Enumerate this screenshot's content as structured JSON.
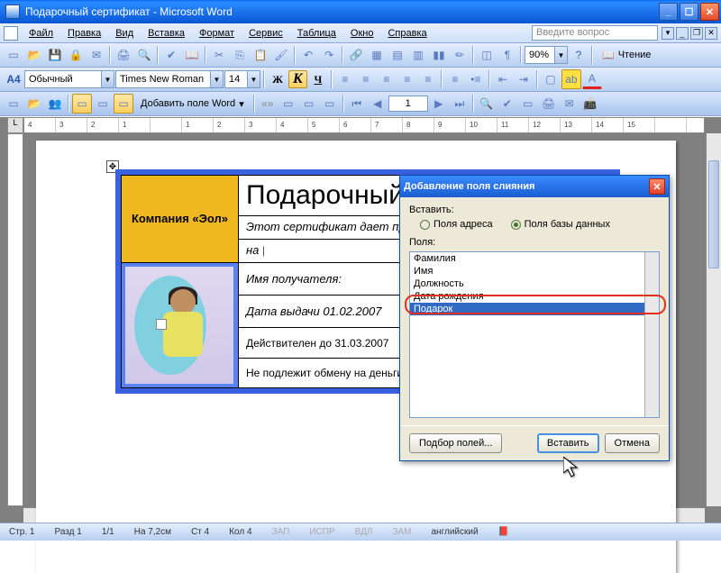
{
  "window": {
    "title": "Подарочный сертификат - Microsoft Word"
  },
  "menu": {
    "file": "Файл",
    "edit": "Правка",
    "view": "Вид",
    "insert": "Вставка",
    "format": "Формат",
    "tools": "Сервис",
    "table": "Таблица",
    "window": "Окно",
    "help": "Справка",
    "help_placeholder": "Введите вопрос"
  },
  "toolbar1": {
    "zoom": "90%",
    "reading": "Чтение"
  },
  "toolbar2": {
    "style_label": "A4",
    "style": "Обычный",
    "font": "Times New Roman",
    "size": "14",
    "bold": "Ж",
    "italic": "К",
    "underline": "Ч"
  },
  "toolbar3": {
    "add_field": "Добавить поле Word",
    "record": "1"
  },
  "ruler": {
    "marks": [
      "4",
      "3",
      "2",
      "1",
      "",
      "1",
      "2",
      "3",
      "4",
      "5",
      "6",
      "7",
      "8",
      "9",
      "10",
      "11",
      "12",
      "13",
      "14",
      "15"
    ]
  },
  "document": {
    "company": "Компания «Эол»",
    "heading": "Подарочный сертификат",
    "line_this": "Этот сертификат дает право",
    "line_na": "на",
    "line_name": "Имя получателя:",
    "line_date": "Дата выдачи 01.02.2007",
    "line_valid": "Действителен до 31.03.2007",
    "line_noexch": "Не подлежит обмену на деньги"
  },
  "dialog": {
    "title": "Добавление поля слияния",
    "insert_label": "Вставить:",
    "radio_address": "Поля адреса",
    "radio_db": "Поля базы данных",
    "fields_label": "Поля:",
    "items": [
      "Фамилия",
      "Имя",
      "Должность",
      "Дата рождения",
      "Подарок"
    ],
    "selected": "Подарок",
    "btn_match": "Подбор полей...",
    "btn_insert": "Вставить",
    "btn_cancel": "Отмена"
  },
  "status": {
    "page": "Стр. 1",
    "section": "Разд 1",
    "pages": "1/1",
    "at": "На 7,2см",
    "line": "Ст 4",
    "col": "Кол 4",
    "rec": "ЗАП",
    "fix": "ИСПР",
    "ext": "ВДЛ",
    "ovr": "ЗАМ",
    "lang": "английский"
  }
}
